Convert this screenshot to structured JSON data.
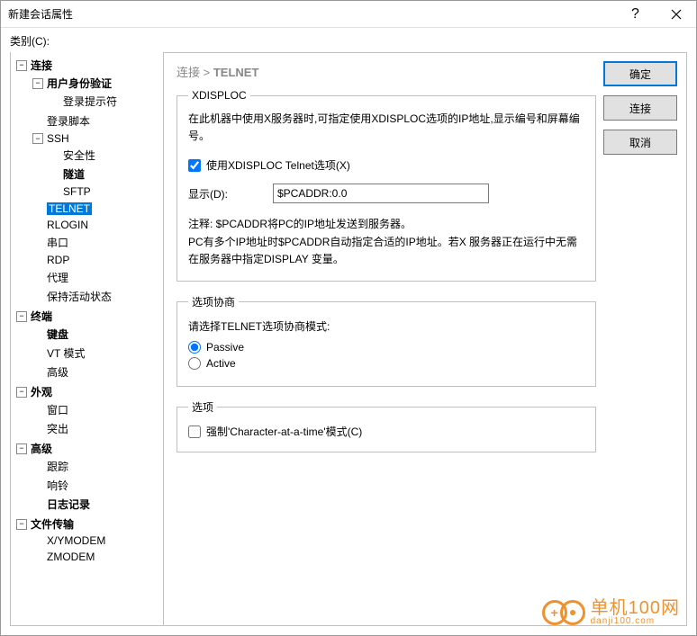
{
  "window": {
    "title": "新建会话属性"
  },
  "category_label": "类别(C):",
  "tree": {
    "connection": "连接",
    "auth": "用户身份验证",
    "login_prompt": "登录提示符",
    "login_script": "登录脚本",
    "ssh": "SSH",
    "security": "安全性",
    "tunnel": "隧道",
    "sftp": "SFTP",
    "telnet": "TELNET",
    "rlogin": "RLOGIN",
    "serial": "串口",
    "rdp": "RDP",
    "proxy": "代理",
    "keepalive": "保持活动状态",
    "terminal": "终端",
    "keyboard": "键盘",
    "vtmode": "VT 模式",
    "advanced_t": "高级",
    "appearance": "外观",
    "window_a": "窗口",
    "highlight": "突出",
    "advanced": "高级",
    "trace": "跟踪",
    "bell": "响铃",
    "logging": "日志记录",
    "filetransfer": "文件传输",
    "xymodem": "X/YMODEM",
    "zmodem": "ZMODEM"
  },
  "breadcrumb": {
    "root": "连接",
    "sep": ">",
    "current": "TELNET"
  },
  "xdisploc": {
    "legend": "XDISPLOC",
    "desc": "在此机器中使用X服务器时,可指定使用XDISPLOC选项的IP地址,显示编号和屏幕编号。",
    "checkbox": "使用XDISPLOC Telnet选项(X)",
    "display_label": "显示(D):",
    "display_value": "$PCADDR:0.0",
    "note1": "注释: $PCADDR将PC的IP地址发送到服务器。",
    "note2": "PC有多个IP地址时$PCADDR自动指定合适的IP地址。若X 服务器正在运行中无需在服务器中指定DISPLAY 变量。"
  },
  "negotiation": {
    "legend": "选项协商",
    "prompt": "请选择TELNET选项协商模式:",
    "passive": "Passive",
    "active": "Active"
  },
  "options": {
    "legend": "选项",
    "force_char": "强制'Character-at-a-time'模式(C)"
  },
  "buttons": {
    "ok": "确定",
    "connect": "连接",
    "cancel": "取消"
  },
  "watermark": {
    "big": "单机100网",
    "small": "danji100.com"
  }
}
